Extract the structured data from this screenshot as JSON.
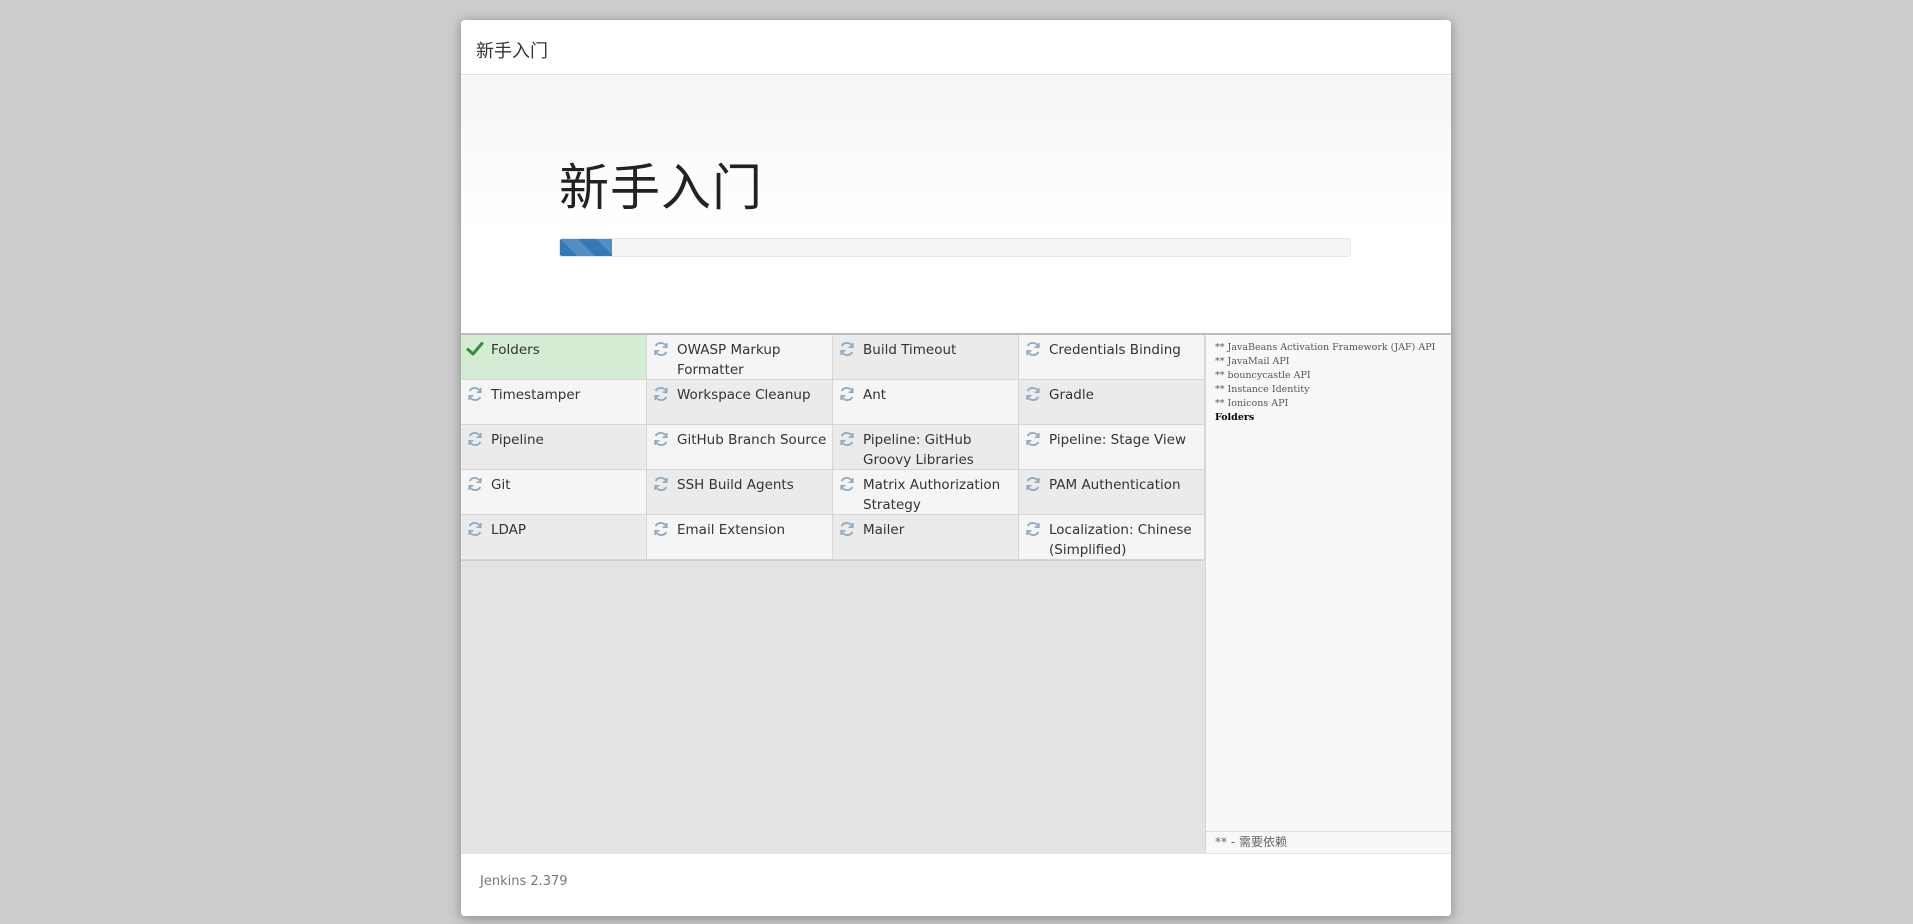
{
  "header": {
    "title": "新手入门"
  },
  "hero": {
    "title": "新手入门",
    "progress_percent": 6.6
  },
  "plugins": [
    {
      "label": "Folders",
      "status": "installed",
      "icon": "check-icon"
    },
    {
      "label": "OWASP Markup Formatter",
      "status": "pending",
      "icon": "refresh-icon"
    },
    {
      "label": "Build Timeout",
      "status": "pending",
      "icon": "refresh-icon"
    },
    {
      "label": "Credentials Binding",
      "status": "pending",
      "icon": "refresh-icon"
    },
    {
      "label": "Timestamper",
      "status": "pending",
      "icon": "refresh-icon"
    },
    {
      "label": "Workspace Cleanup",
      "status": "pending",
      "icon": "refresh-icon"
    },
    {
      "label": "Ant",
      "status": "pending",
      "icon": "refresh-icon"
    },
    {
      "label": "Gradle",
      "status": "pending",
      "icon": "refresh-icon"
    },
    {
      "label": "Pipeline",
      "status": "pending",
      "icon": "refresh-icon"
    },
    {
      "label": "GitHub Branch Source",
      "status": "pending",
      "icon": "refresh-icon"
    },
    {
      "label": "Pipeline: GitHub Groovy Libraries",
      "status": "pending",
      "icon": "refresh-icon"
    },
    {
      "label": "Pipeline: Stage View",
      "status": "pending",
      "icon": "refresh-icon"
    },
    {
      "label": "Git",
      "status": "pending",
      "icon": "refresh-icon"
    },
    {
      "label": "SSH Build Agents",
      "status": "pending",
      "icon": "refresh-icon"
    },
    {
      "label": "Matrix Authorization Strategy",
      "status": "pending",
      "icon": "refresh-icon"
    },
    {
      "label": "PAM Authentication",
      "status": "pending",
      "icon": "refresh-icon"
    },
    {
      "label": "LDAP",
      "status": "pending",
      "icon": "refresh-icon"
    },
    {
      "label": "Email Extension",
      "status": "pending",
      "icon": "refresh-icon"
    },
    {
      "label": "Mailer",
      "status": "pending",
      "icon": "refresh-icon"
    },
    {
      "label": "Localization: Chinese (Simplified)",
      "status": "pending",
      "icon": "refresh-icon"
    }
  ],
  "log": {
    "lines": [
      {
        "text": "** JavaBeans Activation Framework (JAF) API",
        "current": false
      },
      {
        "text": "** JavaMail API",
        "current": false
      },
      {
        "text": "** bouncycastle API",
        "current": false
      },
      {
        "text": "** Instance Identity",
        "current": false
      },
      {
        "text": "** Ionicons API",
        "current": false
      },
      {
        "text": "Folders",
        "current": true
      }
    ],
    "legend": "** - 需要依赖"
  },
  "footer": {
    "version": "Jenkins 2.379"
  },
  "colors": {
    "installed_bg": "#d4ebd4",
    "check": "#3c8a3c",
    "refresh": "#8fa9c0",
    "progress": "#337ab7"
  }
}
